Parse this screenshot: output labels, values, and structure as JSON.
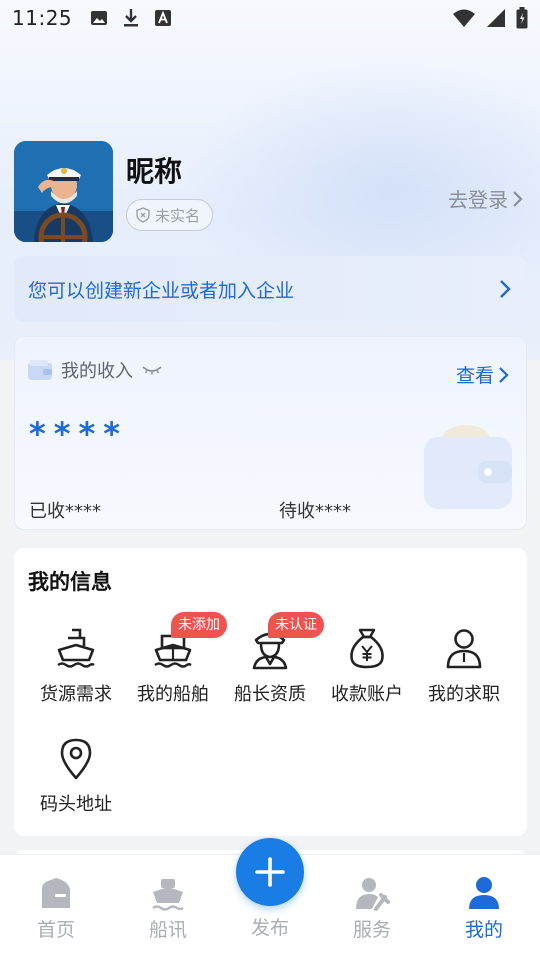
{
  "status_bar": {
    "time": "11:25",
    "left_icons": [
      "image-icon",
      "download-icon",
      "font-icon"
    ],
    "right_icons": [
      "wifi-icon",
      "signal-icon",
      "battery-icon"
    ]
  },
  "profile": {
    "nickname": "昵称",
    "realname_badge": "未实名",
    "login_link": "去登录"
  },
  "enterprise": {
    "text": "您可以创建新企业或者加入企业"
  },
  "income": {
    "title": "我的收入",
    "view_label": "查看",
    "amount": "****",
    "received": "已收****",
    "pending": "待收****"
  },
  "my_info": {
    "title": "我的信息",
    "items": [
      {
        "label": "货源需求",
        "icon": "cargo-ship-icon",
        "tag": ""
      },
      {
        "label": "我的船舶",
        "icon": "ship-icon",
        "tag": "未添加"
      },
      {
        "label": "船长资质",
        "icon": "captain-icon",
        "tag": "未认证"
      },
      {
        "label": "收款账户",
        "icon": "money-bag-icon",
        "tag": ""
      },
      {
        "label": "我的求职",
        "icon": "person-icon",
        "tag": ""
      },
      {
        "label": "码头地址",
        "icon": "location-pin-icon",
        "tag": ""
      }
    ]
  },
  "tabbar": {
    "tabs": [
      {
        "label": "首页",
        "icon": "home-icon",
        "active": false
      },
      {
        "label": "船讯",
        "icon": "ship-news-icon",
        "active": false
      },
      {
        "label": "发布",
        "icon": "plus-icon",
        "active": false
      },
      {
        "label": "服务",
        "icon": "service-icon",
        "active": false
      },
      {
        "label": "我的",
        "icon": "user-icon",
        "active": true
      }
    ]
  },
  "colors": {
    "accent": "#1d6ad8",
    "tag_red": "#ef5350",
    "inactive_tab": "#a9adb4"
  }
}
